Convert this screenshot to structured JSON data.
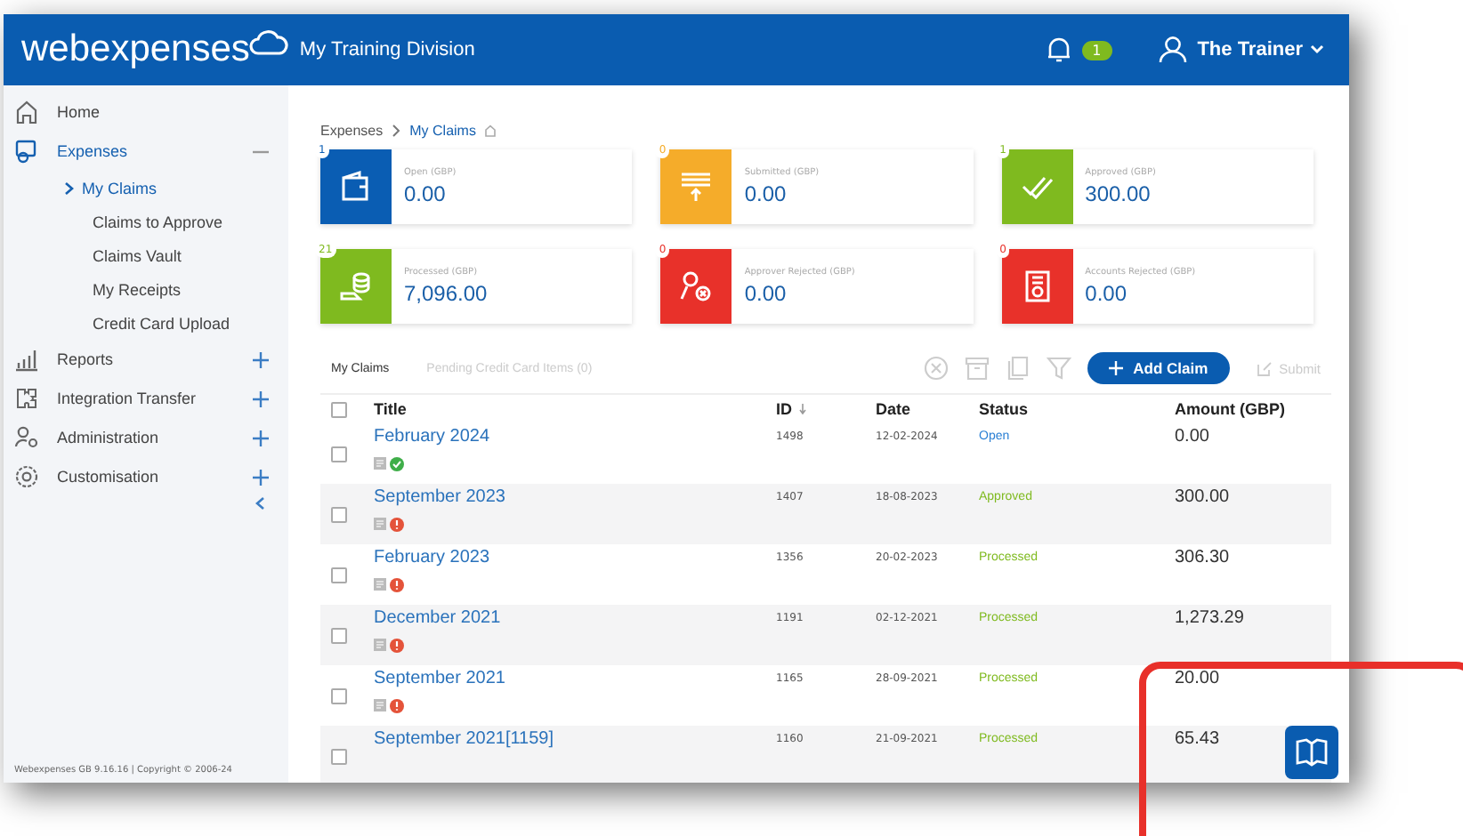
{
  "header": {
    "logo": "webexpenses",
    "division": "My Training Division",
    "notifications": "1",
    "user": "The Trainer"
  },
  "sidebar": {
    "items": [
      {
        "label": "Home"
      },
      {
        "label": "Expenses",
        "expanded": true,
        "children": [
          {
            "label": "My Claims",
            "selected": true
          },
          {
            "label": "Claims to Approve",
            "selected": false
          },
          {
            "label": "Claims Vault",
            "selected": false
          },
          {
            "label": "My Receipts",
            "selected": false
          },
          {
            "label": "Credit Card Upload",
            "selected": false
          }
        ]
      },
      {
        "label": "Reports",
        "expanded": false
      },
      {
        "label": "Integration Transfer",
        "expanded": false
      },
      {
        "label": "Administration",
        "expanded": false
      },
      {
        "label": "Customisation",
        "expanded": false
      }
    ],
    "footer": "Webexpenses GB 9.16.16 | Copyright © 2006-24"
  },
  "breadcrumb": [
    "Expenses",
    "My Claims"
  ],
  "tiles": [
    {
      "label": "Open (GBP)",
      "value": "0.00",
      "count": "1",
      "color": "#0a5db3"
    },
    {
      "label": "Submitted (GBP)",
      "value": "0.00",
      "count": "0",
      "color": "#f5ac2a"
    },
    {
      "label": "Approved (GBP)",
      "value": "300.00",
      "count": "1",
      "color": "#7fba1f"
    },
    {
      "label": "Processed (GBP)",
      "value": "7,096.00",
      "count": "21",
      "color": "#7fba1f"
    },
    {
      "label": "Approver Rejected (GBP)",
      "value": "0.00",
      "count": "0",
      "color": "#e8312a"
    },
    {
      "label": "Accounts Rejected (GBP)",
      "value": "0.00",
      "count": "0",
      "color": "#e8312a"
    }
  ],
  "tabs": [
    {
      "label": "My Claims",
      "selected": true
    },
    {
      "label": "Pending Credit Card Items (0)",
      "selected": false
    }
  ],
  "toolbar": {
    "add": "Add Claim",
    "submit": "Submit"
  },
  "table": {
    "all_checked": false,
    "columns": [
      "Title",
      "ID",
      "Date",
      "Status",
      "Amount (GBP)"
    ],
    "rows": [
      {
        "title": "February 2024",
        "id": "1498",
        "date": "12-02-2024",
        "status": "Open",
        "color": "#2a7fd4",
        "valid": true,
        "checked": false,
        "amount": "0.00"
      },
      {
        "title": "September 2023",
        "id": "1407",
        "date": "18-08-2023",
        "status": "Approved",
        "color": "#7fba1f",
        "valid": false,
        "checked": false,
        "amount": "300.00"
      },
      {
        "title": "February 2023",
        "id": "1356",
        "date": "20-02-2023",
        "status": "Processed",
        "color": "#7fba1f",
        "valid": false,
        "checked": false,
        "amount": "306.30"
      },
      {
        "title": "December 2021",
        "id": "1191",
        "date": "02-12-2021",
        "status": "Processed",
        "color": "#7fba1f",
        "valid": false,
        "checked": false,
        "amount": "1,273.29"
      },
      {
        "title": "September 2021",
        "id": "1165",
        "date": "28-09-2021",
        "status": "Processed",
        "color": "#7fba1f",
        "valid": false,
        "checked": false,
        "amount": "20.00"
      },
      {
        "title": "September 2021[1159]",
        "id": "1160",
        "date": "21-09-2021",
        "status": "Processed",
        "color": "#7fba1f",
        "checked": false,
        "amount": "65.43"
      }
    ]
  }
}
